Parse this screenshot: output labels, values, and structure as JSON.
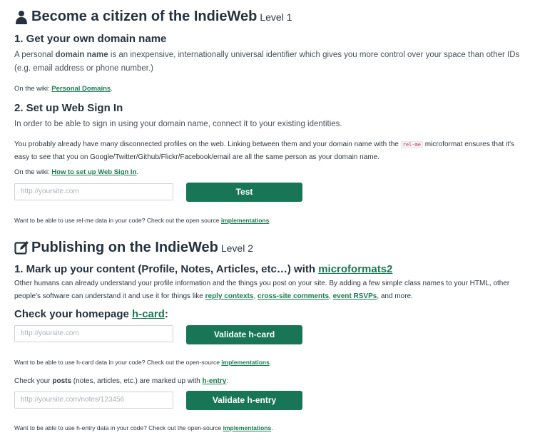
{
  "level1": {
    "title": "Become a citizen of the IndieWeb",
    "level": "Level 1",
    "icon": "person-icon",
    "step1": {
      "heading": "1. Get your own domain name",
      "lead_pre": "A personal ",
      "lead_bold": "domain name",
      "lead_post": " is an inexpensive, internationally universal identifier which gives you more control over your space than other IDs (e.g. email address or phone number.)",
      "wiki_prefix": "On the wiki: ",
      "wiki_link": "Personal Domains",
      "wiki_suffix": "."
    },
    "step2": {
      "heading": "2. Set up Web Sign In",
      "lead": "In order to be able to sign in using your domain name, connect it to your existing identities.",
      "body_pre": "You probably already have many disconnected profiles on the web. Linking between them and your domain name with the ",
      "body_code": "rel-me",
      "body_post": " microformat ensures that it's easy to see that you on Google/Twitter/Github/Flickr/Facebook/email are all the same person as your domain name.",
      "wiki_prefix": "On the wiki: ",
      "wiki_link": "How to set up Web Sign In",
      "wiki_suffix": ".",
      "input_placeholder": "http://yoursite.com",
      "button": "Test",
      "note_pre": "Want to be able to use rel-me data in your code? Check out the open source ",
      "note_link": "implementations",
      "note_suffix": "."
    }
  },
  "level2": {
    "title": "Publishing on the IndieWeb",
    "level": "Level 2",
    "icon": "edit-icon",
    "step1": {
      "heading_pre": "1. Mark up your content (Profile, Notes, Articles, etc…) with ",
      "heading_link": "microformats2",
      "body_pre": "Other humans can already understand your profile information and the things you post on your site. By adding a few simple class names to your HTML, other people's software can understand it and use it for things like ",
      "link_reply": "reply contexts",
      "sep1": ", ",
      "link_cross": "cross-site comments",
      "sep2": ", ",
      "link_rsvp": "event RSVPs",
      "body_post": ", and more."
    },
    "hcard": {
      "heading_pre": "Check your homepage ",
      "heading_link": "h-card",
      "heading_suffix": ":",
      "input_placeholder": "http://yoursite.com",
      "button": "Validate h-card",
      "note_pre": "Want to be able to use h-card data in your code? Check out the open-source ",
      "note_link": "implementations",
      "note_suffix": "."
    },
    "hentry": {
      "label_pre": "Check your ",
      "label_bold": "posts",
      "label_mid": " (notes, articles, etc.) are marked up with ",
      "label_link": "h-entry",
      "label_suffix": ":",
      "input_placeholder": "http://yoursite.com/notes/123456",
      "button": "Validate h-entry",
      "note_pre": "Want to be able to use h-entry data in your code? Check out the open-source ",
      "note_link": "implementations",
      "note_suffix": "."
    }
  },
  "colors": {
    "accent": "#187656",
    "link": "#1a7a53",
    "heading": "#25323d"
  }
}
